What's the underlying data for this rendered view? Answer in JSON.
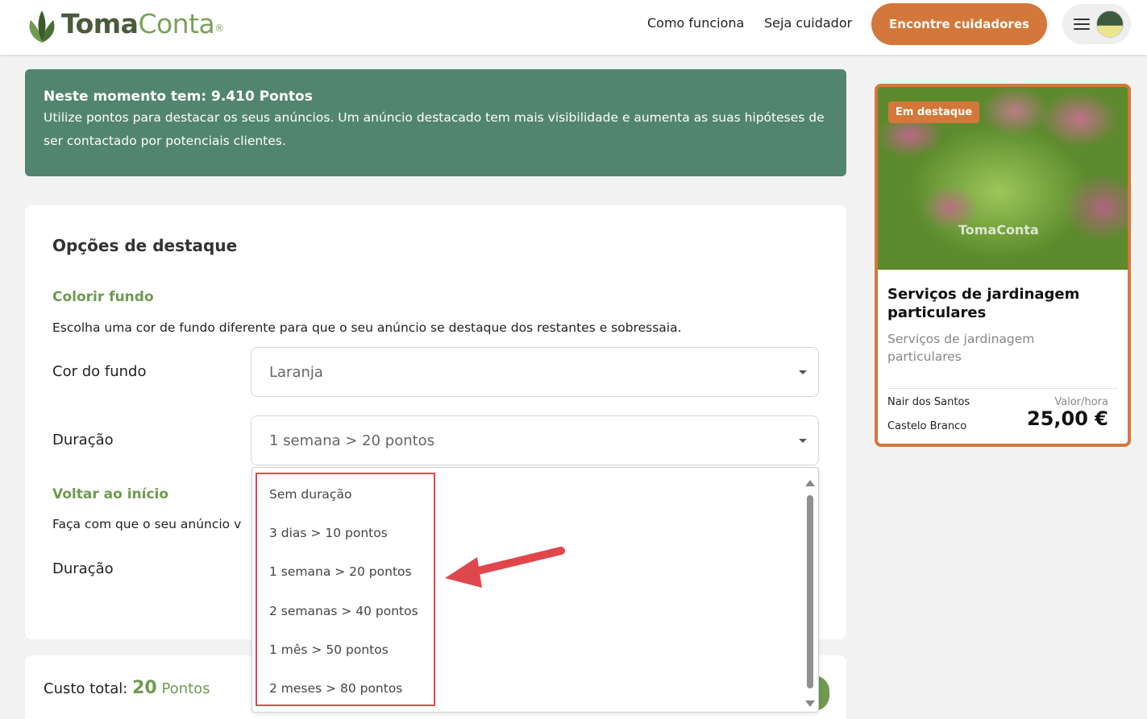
{
  "header": {
    "logo_part1": "Toma",
    "logo_part2": "Conta",
    "logo_mark": "tomaconta-leaf-logo",
    "nav_how": "Como funciona",
    "nav_caregiver": "Seja cuidador",
    "cta_label": "Encontre cuidadores",
    "menu_icon": "hamburger-icon"
  },
  "banner": {
    "title": "Neste momento tem: 9.410 Pontos",
    "text": "Utilize pontos para destacar os seus anúncios. Um anúncio destacado tem mais visibilidade e aumenta as suas hipóteses de ser contactado por potenciais clientes."
  },
  "options": {
    "title": "Opções de destaque",
    "color_section": {
      "title": "Colorir fundo",
      "desc": "Escolha uma cor de fundo diferente para que o seu anúncio se destaque dos restantes e sobressaia.",
      "color_label": "Cor do fundo",
      "color_value": "Laranja",
      "duration_label": "Duração",
      "duration_value": "1 semana > 20 pontos"
    },
    "top_section": {
      "title": "Voltar ao início",
      "desc": "Faça com que o seu anúncio v",
      "duration_label": "Duração"
    }
  },
  "dropdown": {
    "items": [
      "Sem duração",
      "3 dias > 10 pontos",
      "1 semana > 20 pontos",
      "2 semanas > 40 pontos",
      "1 mês > 50 pontos",
      "2 meses > 80 pontos"
    ]
  },
  "total": {
    "label": "Custo total:",
    "value": "20",
    "unit": "Pontos"
  },
  "featured": {
    "badge": "Em destaque",
    "watermark": "TomaConta",
    "title": "Serviços de jardinagem particulares",
    "subtitle": "Serviços de jardinagem particulares",
    "name": "Nair dos Santos",
    "city": "Castelo Branco",
    "rate_label": "Valor/hora",
    "price": "25,00 €"
  },
  "colors": {
    "brand_green": "#528570",
    "accent_orange": "#d3783a",
    "section_green": "#6f9a50",
    "annotation_red": "#e0474c"
  }
}
